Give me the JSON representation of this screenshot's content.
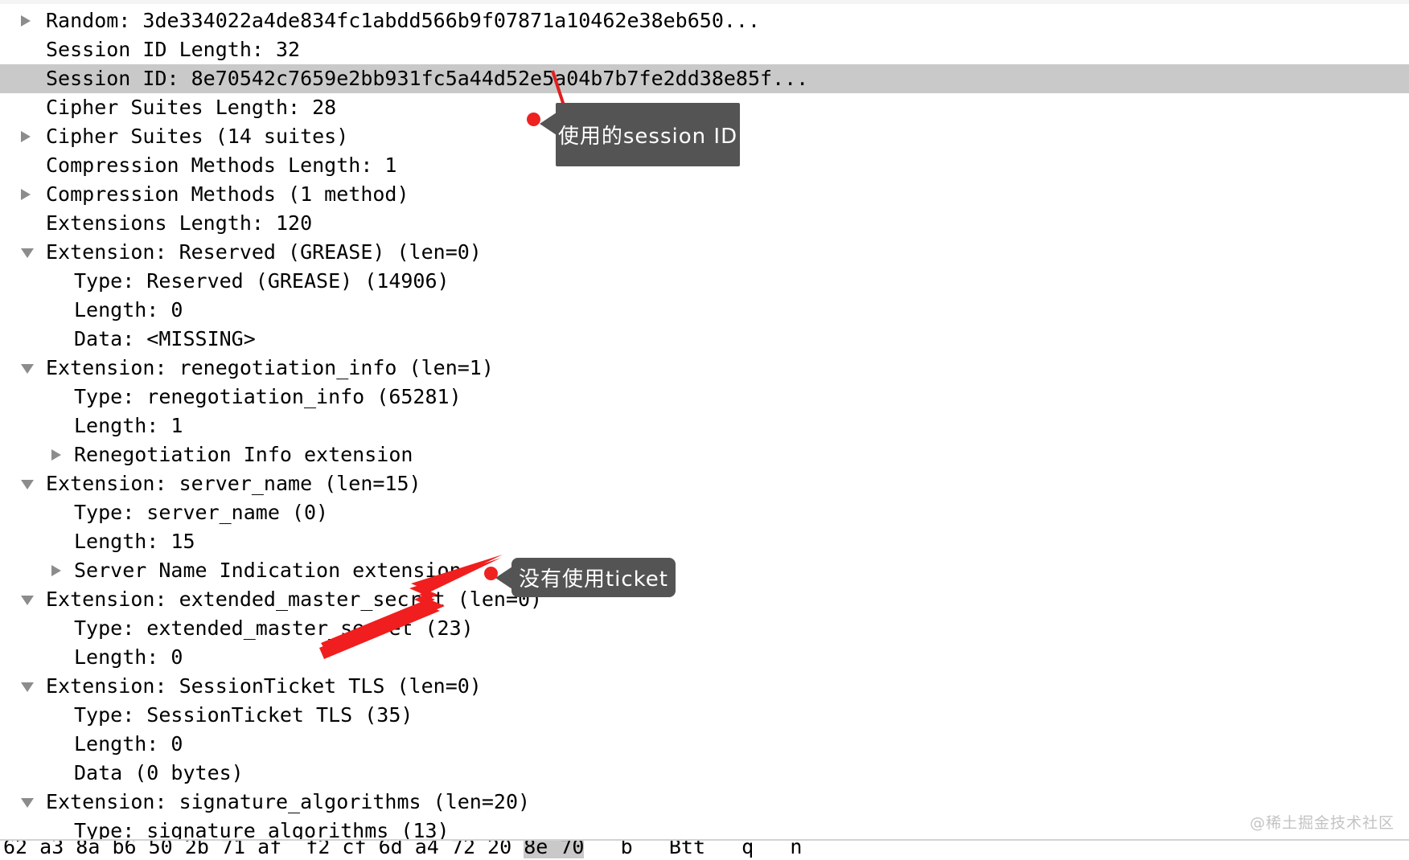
{
  "app": "wireshark-packet-details",
  "colors": {
    "selection": "#c9c9c9",
    "callout_bg": "#545454",
    "callout_text": "#ffffff",
    "marker_red": "#ef2222",
    "arrow_red": "#f01e1e",
    "twisty": "#8c8c8c",
    "watermark": "#c3c3c3"
  },
  "tree": {
    "rows": [
      {
        "indent": 1,
        "twisty": "collapsed",
        "selected": false,
        "text": "Random: 3de334022a4de834fc1abdd566b9f07871a10462e38eb650..."
      },
      {
        "indent": 1,
        "twisty": "none",
        "selected": false,
        "text": "Session ID Length: 32"
      },
      {
        "indent": 1,
        "twisty": "none",
        "selected": true,
        "text": "Session ID: 8e70542c7659e2bb931fc5a44d52e5a04b7b7fe2dd38e85f..."
      },
      {
        "indent": 1,
        "twisty": "none",
        "selected": false,
        "text": "Cipher Suites Length: 28"
      },
      {
        "indent": 1,
        "twisty": "collapsed",
        "selected": false,
        "text": "Cipher Suites (14 suites)"
      },
      {
        "indent": 1,
        "twisty": "none",
        "selected": false,
        "text": "Compression Methods Length: 1"
      },
      {
        "indent": 1,
        "twisty": "collapsed",
        "selected": false,
        "text": "Compression Methods (1 method)"
      },
      {
        "indent": 1,
        "twisty": "none",
        "selected": false,
        "text": "Extensions Length: 120"
      },
      {
        "indent": 1,
        "twisty": "expanded",
        "selected": false,
        "text": "Extension: Reserved (GREASE) (len=0)"
      },
      {
        "indent": 2,
        "twisty": "none",
        "selected": false,
        "text": "Type: Reserved (GREASE) (14906)"
      },
      {
        "indent": 2,
        "twisty": "none",
        "selected": false,
        "text": "Length: 0"
      },
      {
        "indent": 2,
        "twisty": "none",
        "selected": false,
        "text": "Data: <MISSING>"
      },
      {
        "indent": 1,
        "twisty": "expanded",
        "selected": false,
        "text": "Extension: renegotiation_info (len=1)"
      },
      {
        "indent": 2,
        "twisty": "none",
        "selected": false,
        "text": "Type: renegotiation_info (65281)"
      },
      {
        "indent": 2,
        "twisty": "none",
        "selected": false,
        "text": "Length: 1"
      },
      {
        "indent": 2,
        "twisty": "collapsed",
        "selected": false,
        "text": "Renegotiation Info extension"
      },
      {
        "indent": 1,
        "twisty": "expanded",
        "selected": false,
        "text": "Extension: server_name (len=15)"
      },
      {
        "indent": 2,
        "twisty": "none",
        "selected": false,
        "text": "Type: server_name (0)"
      },
      {
        "indent": 2,
        "twisty": "none",
        "selected": false,
        "text": "Length: 15"
      },
      {
        "indent": 2,
        "twisty": "collapsed",
        "selected": false,
        "text": "Server Name Indication extension"
      },
      {
        "indent": 1,
        "twisty": "expanded",
        "selected": false,
        "text": "Extension: extended_master_secret (len=0)"
      },
      {
        "indent": 2,
        "twisty": "none",
        "selected": false,
        "text": "Type: extended_master_secret (23)"
      },
      {
        "indent": 2,
        "twisty": "none",
        "selected": false,
        "text": "Length: 0"
      },
      {
        "indent": 1,
        "twisty": "expanded",
        "selected": false,
        "text": "Extension: SessionTicket TLS (len=0)"
      },
      {
        "indent": 2,
        "twisty": "none",
        "selected": false,
        "text": "Type: SessionTicket TLS (35)"
      },
      {
        "indent": 2,
        "twisty": "none",
        "selected": false,
        "text": "Length: 0"
      },
      {
        "indent": 2,
        "twisty": "none",
        "selected": false,
        "text": "Data (0 bytes)"
      },
      {
        "indent": 1,
        "twisty": "expanded",
        "selected": false,
        "text": "Extension: signature_algorithms (len=20)"
      },
      {
        "indent": 2,
        "twisty": "none",
        "selected": false,
        "text": "Type: signature_algorithms (13)"
      }
    ]
  },
  "annotations": {
    "session_callout": "使用的session ID",
    "ticket_callout": "没有使用ticket"
  },
  "bytes_pane": {
    "hex_prefix": "62 a3 8a b6 50 2b 71 af  f2 cf 6d a4 72 20 ",
    "hex_highlight": "8e 70",
    "ascii_tail": "   b   Btt   q   n  "
  },
  "watermark": "@稀土掘金技术社区"
}
